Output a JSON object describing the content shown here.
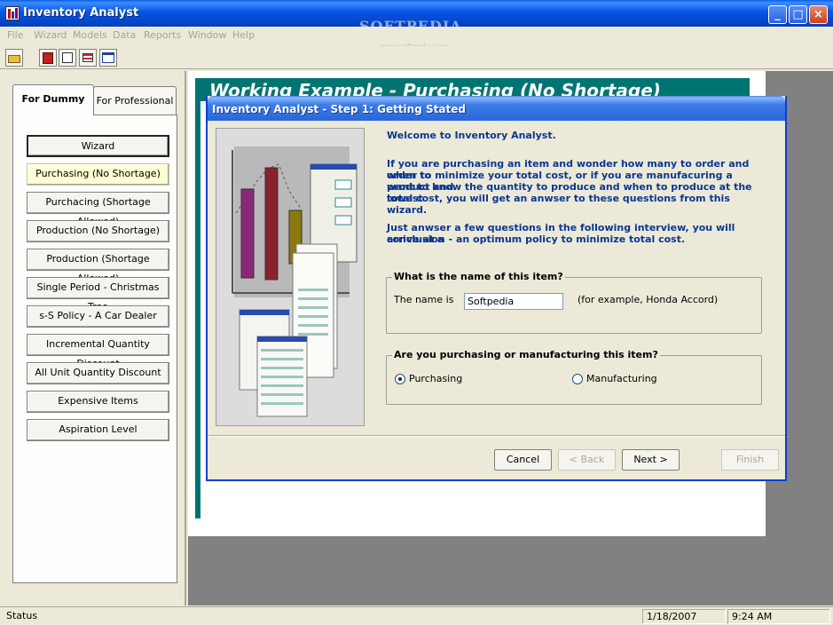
{
  "app": {
    "title": "Inventory Analyst",
    "watermark": "SOFTPEDIA",
    "watermark_url": "www.softpedia.com"
  },
  "window_controls": {
    "minimize": "_",
    "maximize": "□",
    "close": "×"
  },
  "menu": [
    "File",
    "Wizard",
    "Models",
    "Data",
    "Reports",
    "Window",
    "Help"
  ],
  "toolbar": {
    "icons": [
      "open-folder-icon",
      "book-icon",
      "calendar-icon",
      "chart-icon",
      "table-icon"
    ]
  },
  "left_panel": {
    "tabs": [
      "For Dummy",
      "For Professional"
    ],
    "active_tab": "For Dummy",
    "buttons": [
      "Wizard",
      "Purchasing  (No Shortage)",
      "Purchacing (Shortage Allowed)",
      "Production (No Shortage)",
      "Production (Shortage Allowed)",
      "Single Period - Christmas Tree",
      "s-S Policy - A Car Dealer",
      "Incremental Quantity Discount",
      "All Unit Quantity Discount",
      "Expensive Items",
      "Aspiration Level"
    ],
    "selected_button": "Purchasing  (No Shortage)"
  },
  "document": {
    "title": "Working Example - Purchasing (No Shortage)"
  },
  "dialog": {
    "title": "Inventory Analyst - Step 1: Getting Stated",
    "welcome": "Welcome to Inventory Analyst.",
    "intro_line1": "If you are purchasing an item and wonder how many to order and when to",
    "intro_line2": "order to minimize your total cost, or if you are manufacuring a product and",
    "intro_line3": "want to know the quantity to produce and when to produce at the lowest",
    "intro_line4": "total cost, you will get an anwser to these questions from this wizard.",
    "interview_line1": "Just anwser a few questions in the following interview, you will arrive at a",
    "interview_line2": "conclusion - an optimum policy to minimize total cost.",
    "name_group": {
      "legend": "What is the name of this item?",
      "label": "The name is",
      "value": "Softpedia",
      "hint": "(for example, Honda Accord)"
    },
    "type_group": {
      "legend": "Are you purchasing or manufacturing this item?",
      "options": [
        "Purchasing",
        "Manufacturing"
      ],
      "selected": "Purchasing"
    },
    "buttons": {
      "cancel": "Cancel",
      "back": "< Back",
      "next": "Next >",
      "finish": "Finish"
    }
  },
  "status": {
    "text": "Status",
    "date": "1/18/2007",
    "time": "9:24 AM"
  }
}
